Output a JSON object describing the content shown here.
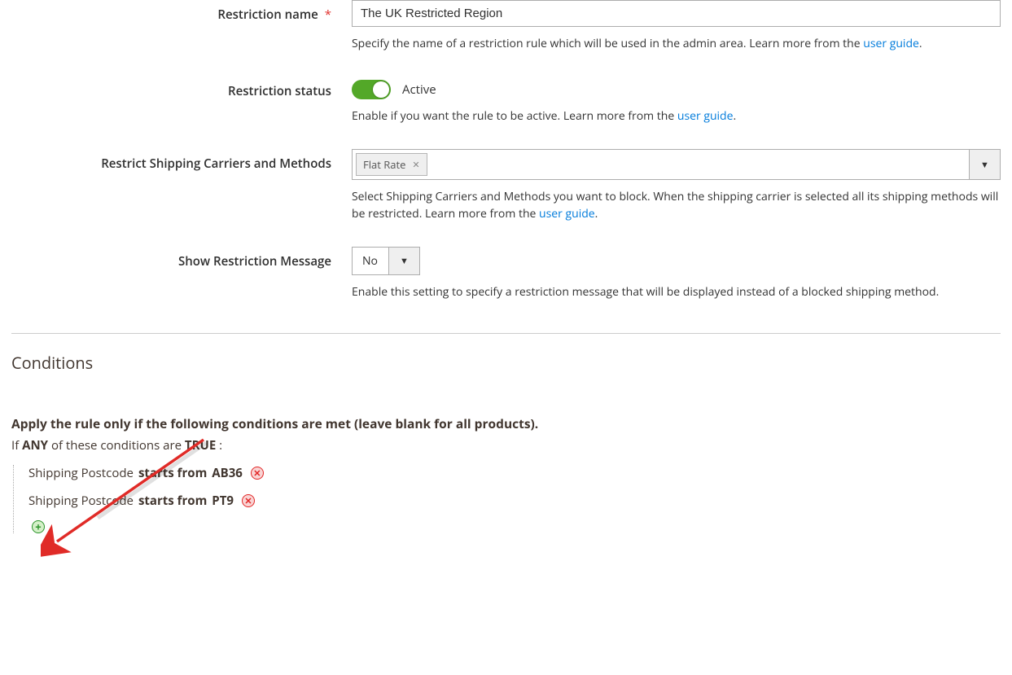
{
  "fields": {
    "name": {
      "label": "Restriction name",
      "required_mark": "*",
      "value": "The UK Restricted Region",
      "hint_pre": "Specify the name of a restriction rule which will be used in the admin area. Learn more from the ",
      "hint_link": "user guide",
      "hint_post": "."
    },
    "status": {
      "label": "Restriction status",
      "value_label": "Active",
      "hint_pre": "Enable if you want the rule to be active. Learn more from the ",
      "hint_link": "user guide",
      "hint_post": "."
    },
    "carriers": {
      "label": "Restrict Shipping Carriers and Methods",
      "tags": [
        "Flat Rate"
      ],
      "hint_pre": "Select Shipping Carriers and Methods you want to block. When the shipping carrier is selected all its shipping methods will be restricted. Learn more from the ",
      "hint_link": "user guide",
      "hint_post": "."
    },
    "message": {
      "label": "Show Restriction Message",
      "value": "No",
      "hint": "Enable this setting to specify a restriction message that will be displayed instead of a blocked shipping method."
    }
  },
  "conditions": {
    "section_title": "Conditions",
    "heading": "Apply the rule only if the following conditions are met (leave blank for all products).",
    "root": {
      "prefix": "If ",
      "aggregator": "ANY",
      "middle": "  of these conditions are ",
      "value": "TRUE",
      "suffix": " :"
    },
    "items": [
      {
        "attribute": "Shipping Postcode",
        "operator": "starts from",
        "value": "AB36"
      },
      {
        "attribute": "Shipping Postcode",
        "operator": "starts from",
        "value": "PT9"
      }
    ]
  }
}
